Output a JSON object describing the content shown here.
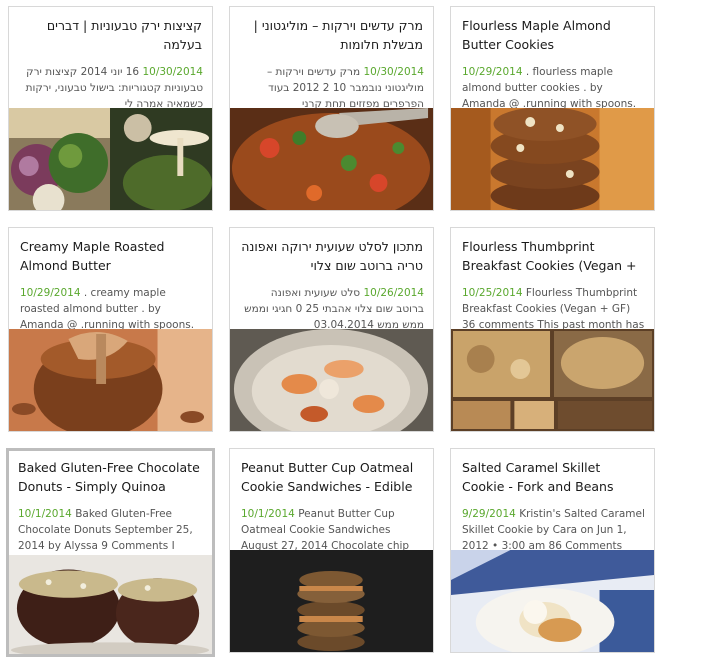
{
  "cards": [
    {
      "title": "קציצות ירק טבעוניות | דברים בעלמה",
      "date": "10/30/2014",
      "snippet": "16 יוני 2014 קציצות ירק טבעוניות קטגוריות: בישול טבעוני, ירקות כשמאיה אמרה לי",
      "rtl": true,
      "image": "ingredients-and-tahini-photo"
    },
    {
      "title": "מרק עדשים וירקות – מוליגטוני | מבשלת חלומות",
      "date": "10/30/2014",
      "snippet": "מרק עדשים וירקות – מוליגטוני נובמבר 10 2 2012 בעוד הפרפרים מפזזים תחת קרני",
      "rtl": true,
      "image": "lentil-soup-photo"
    },
    {
      "title": "Flourless Maple Almond Butter Cookies",
      "date": "10/29/2014",
      "snippet": ". flourless maple almond butter cookies . by Amanda @ .running with spoons.",
      "rtl": false,
      "image": "cookie-stack-photo"
    },
    {
      "title": "Creamy Maple Roasted Almond Butter",
      "date": "10/29/2014",
      "snippet": ". creamy maple roasted almond butter . by Amanda @ .running with spoons.",
      "rtl": false,
      "image": "almond-butter-jar-photo"
    },
    {
      "title": "מתכון לסלט שעועית ירוקה ואפונה טריה ברוטב שום צלוי",
      "date": "10/26/2014",
      "snippet": "סלט שעועית ואפונה ברוטב שום צלוי אהבתי 25 0 חגיגי וממש ממש ממש 03.04.2014",
      "rtl": true,
      "image": "roasted-garlic-bowl-photo"
    },
    {
      "title": "Flourless Thumbprint Breakfast Cookies (Vegan +",
      "date": "10/25/2014",
      "snippet": "Flourless Thumbprint Breakfast Cookies (Vegan + GF) 36 comments This past month has",
      "rtl": false,
      "image": "oat-ingredients-collage-photo"
    },
    {
      "title": "Baked Gluten-Free Chocolate Donuts - Simply Quinoa",
      "date": "10/1/2014",
      "snippet": "Baked Gluten-Free Chocolate Donuts September 25, 2014 by Alyssa 9 Comments I used",
      "rtl": false,
      "selected": true,
      "image": "chocolate-donut-photo"
    },
    {
      "title": "Peanut Butter Cup Oatmeal Cookie Sandwiches - Edible",
      "date": "10/1/2014",
      "snippet": "Peanut Butter Cup Oatmeal Cookie Sandwiches August 27, 2014 Chocolate chip",
      "rtl": false,
      "image": "cookie-sandwich-stack-photo"
    },
    {
      "title": "Salted Caramel Skillet Cookie - Fork and Beans",
      "date": "9/29/2014",
      "snippet": "Kristin's Salted Caramel Skillet Cookie by Cara on Jun 1, 2012 • 3:00 am 86 Comments",
      "rtl": false,
      "image": "caramel-skillet-cookie-photo"
    }
  ]
}
